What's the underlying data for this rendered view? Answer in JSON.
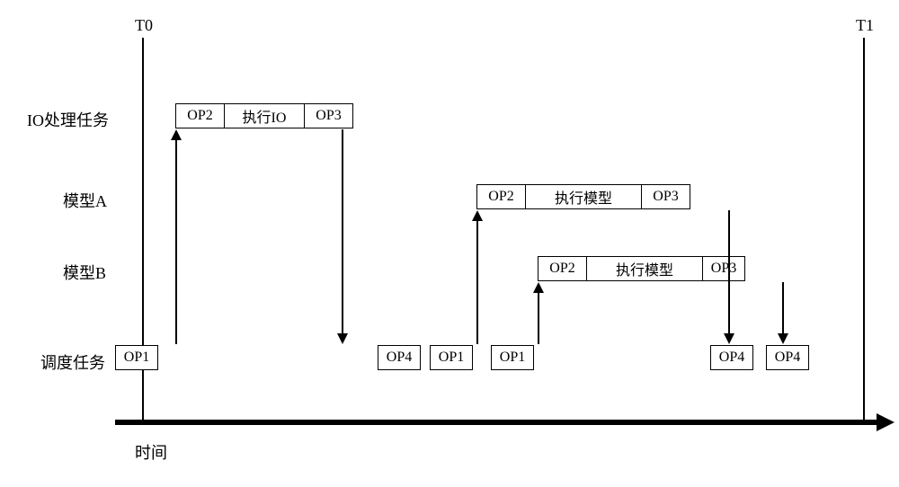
{
  "markers": {
    "t0": "T0",
    "t1": "T1"
  },
  "rows": {
    "io": "IO处理任务",
    "modelA": "模型A",
    "modelB": "模型B",
    "sched": "调度任务"
  },
  "ops": {
    "op1": "OP1",
    "op2": "OP2",
    "op3": "OP3",
    "op4": "OP4"
  },
  "exec": {
    "io": "执行IO",
    "model": "执行模型"
  },
  "axis": "时间",
  "chart_data": {
    "type": "table",
    "title": "Task scheduling timeline between T0 and T1",
    "xlabel": "时间",
    "lanes": [
      "IO处理任务",
      "模型A",
      "模型B",
      "调度任务"
    ],
    "events": [
      {
        "lane": "调度任务",
        "op": "OP1",
        "t": 0,
        "w": 1
      },
      {
        "lane": "调度任务",
        "op": "OP4",
        "t": 6,
        "w": 1
      },
      {
        "lane": "调度任务",
        "op": "OP1",
        "t": 7,
        "w": 1
      },
      {
        "lane": "调度任务",
        "op": "OP1",
        "t": 8.3,
        "w": 1
      },
      {
        "lane": "调度任务",
        "op": "OP4",
        "t": 13,
        "w": 1
      },
      {
        "lane": "调度任务",
        "op": "OP4",
        "t": 14.2,
        "w": 1
      },
      {
        "lane": "IO处理任务",
        "op": "OP2",
        "t": 1,
        "w": 1
      },
      {
        "lane": "IO处理任务",
        "op": "执行IO",
        "t": 2,
        "w": 1.8
      },
      {
        "lane": "IO处理任务",
        "op": "OP3",
        "t": 3.8,
        "w": 1
      },
      {
        "lane": "模型A",
        "op": "OP2",
        "t": 8,
        "w": 1
      },
      {
        "lane": "模型A",
        "op": "执行模型",
        "t": 9,
        "w": 2.5
      },
      {
        "lane": "模型A",
        "op": "OP3",
        "t": 11.5,
        "w": 1
      },
      {
        "lane": "模型B",
        "op": "OP2",
        "t": 9.3,
        "w": 1
      },
      {
        "lane": "模型B",
        "op": "执行模型",
        "t": 10.3,
        "w": 2.5
      },
      {
        "lane": "模型B",
        "op": "OP3",
        "t": 12.8,
        "w": 1
      }
    ],
    "signals": [
      {
        "from": "调度任务",
        "to": "IO处理任务",
        "t": 1,
        "dir": "up"
      },
      {
        "from": "IO处理任务",
        "to": "调度任务",
        "t": 5,
        "dir": "down"
      },
      {
        "from": "调度任务",
        "to": "模型A",
        "t": 8,
        "dir": "up"
      },
      {
        "from": "调度任务",
        "to": "模型B",
        "t": 9.3,
        "dir": "up"
      },
      {
        "from": "模型A",
        "to": "调度任务",
        "t": 12.5,
        "dir": "down"
      },
      {
        "from": "模型B",
        "to": "调度任务",
        "t": 13.8,
        "dir": "down"
      }
    ]
  }
}
